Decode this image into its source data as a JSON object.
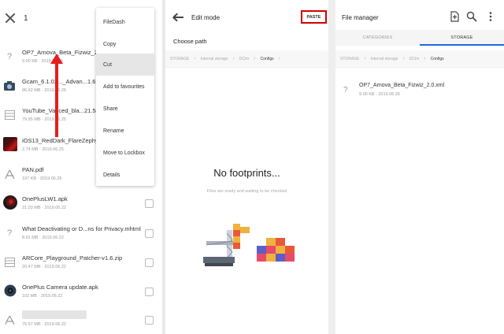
{
  "panel1": {
    "selected_count": "1",
    "files": [
      {
        "name": "OP7_Arnova_Beta_Fizwiz_2.0.",
        "meta": "9.00 KB · 2019.06.26",
        "icon": "unknown-file-icon"
      },
      {
        "name": "Gcam_6.1.02..._Advan...1.6.19",
        "meta": "86.62 MB · 2019.06.25",
        "icon": "camera-app-icon"
      },
      {
        "name": "YouTube_Vanced_bla...21.54",
        "meta": "79.95 MB · 2019.06.25",
        "icon": "archive-file-icon"
      },
      {
        "name": "iOS13_RedDark_FlareZephyr.",
        "meta": "2.74 MB · 2019.06.25",
        "icon": "image-thumbnail"
      },
      {
        "name": "PAN.pdf",
        "meta": "197 KB · 2019.06.25",
        "icon": "pdf-file-icon"
      },
      {
        "name": "OnePlusLW1.apk",
        "meta": "21.03 MB · 2019.06.22",
        "icon": "apk-thumbnail"
      },
      {
        "name": "What Deactivating or D...ns for Privacy.mhtml",
        "meta": "8.91 MB · 2019.06.22",
        "icon": "unknown-file-icon"
      },
      {
        "name": "ARCore_Playground_Patcher-v1.6.zip",
        "meta": "20.47 MB · 2019.06.22",
        "icon": "archive-file-icon"
      },
      {
        "name": "OnePlus Camera update.apk",
        "meta": "102 MB · 2019.06.22",
        "icon": "apk-camera-thumbnail"
      },
      {
        "name": "",
        "meta": "75.57 MB · 2019.06.22",
        "icon": "pdf-file-icon"
      }
    ],
    "context_menu": [
      "FileDash",
      "Copy",
      "Cut",
      "Add to favourites",
      "Share",
      "Rename",
      "Move to Lockbox",
      "Details"
    ],
    "highlighted_menu_item": "Cut"
  },
  "panel2": {
    "title": "Edit mode",
    "paste_label": "PASTE",
    "choose_path": "Choose path",
    "breadcrumbs": [
      "STORAGE",
      "Internal storage",
      "DCim",
      "Configs"
    ],
    "empty_title": "No footprints...",
    "empty_subtitle": "Files are ready and waiting to be checked"
  },
  "panel3": {
    "title": "File manager",
    "tabs": [
      "CATEGORIES",
      "STORAGE"
    ],
    "active_tab": "STORAGE",
    "breadcrumbs": [
      "STORAGE",
      "Internal storage",
      "DCim",
      "Configs"
    ],
    "file": {
      "name": "OP7_Arnova_Beta_Fizwiz_2.0.xml",
      "meta": "9.00 KB · 2019.06.26"
    }
  },
  "colors": {
    "accent_red": "#e41e1e",
    "paste_border": "#d40000",
    "tab_underline": "#1e6cd8"
  }
}
